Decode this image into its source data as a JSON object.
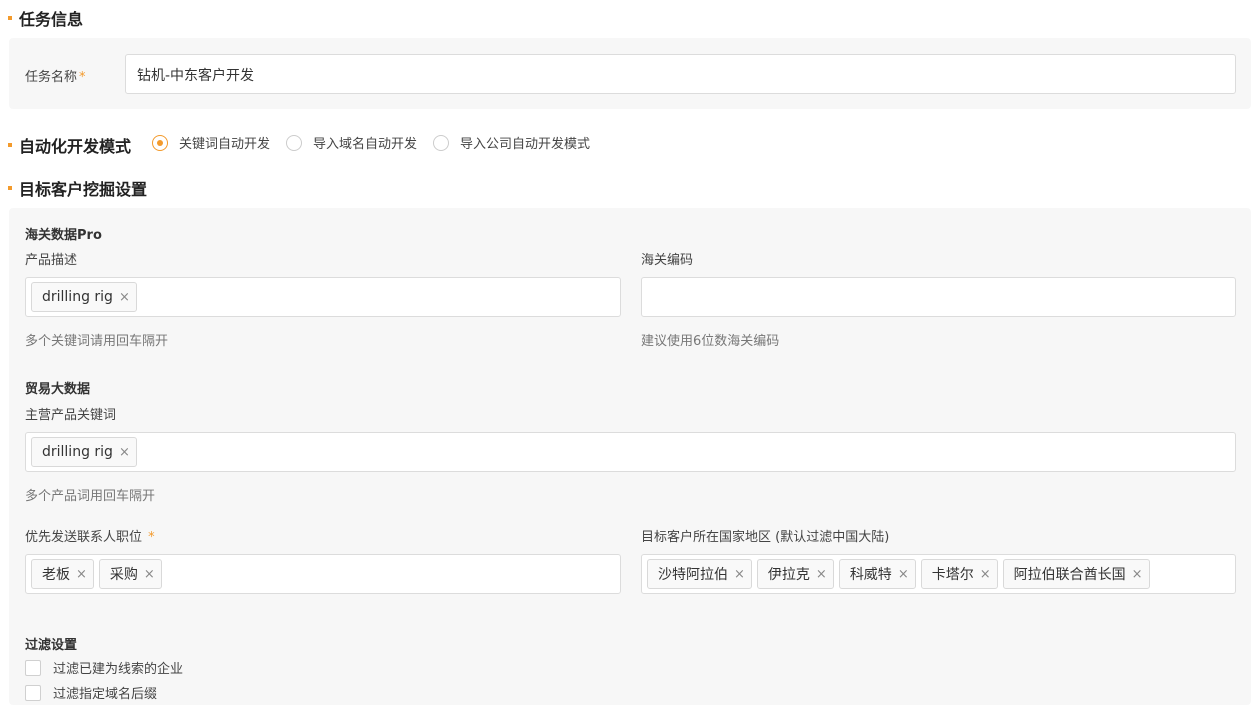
{
  "task_info": {
    "title": "任务信息",
    "name_label": "任务名称",
    "required_mark": "*",
    "name_value": "钻机-中东客户开发"
  },
  "mode": {
    "title": "自动化开发模式",
    "options": [
      {
        "label": "关键词自动开发",
        "selected": true
      },
      {
        "label": "导入域名自动开发",
        "selected": false
      },
      {
        "label": "导入公司自动开发模式",
        "selected": false
      }
    ]
  },
  "target": {
    "title": "目标客户挖掘设置",
    "customs": {
      "title": "海关数据Pro",
      "product_label": "产品描述",
      "product_tags": [
        "drilling rig"
      ],
      "product_hint": "多个关键词请用回车隔开",
      "hs_label": "海关编码",
      "hs_value": "",
      "hs_hint": "建议使用6位数海关编码"
    },
    "trade": {
      "title": "贸易大数据",
      "keywords_label": "主营产品关键词",
      "keywords_tags": [
        "drilling rig"
      ],
      "keywords_hint": "多个产品词用回车隔开"
    },
    "contact": {
      "label": "优先发送联系人职位",
      "required_mark": "*",
      "tags": [
        "老板",
        "采购"
      ]
    },
    "region": {
      "label": "目标客户所在国家地区 (默认过滤中国大陆)",
      "tags": [
        "沙特阿拉伯",
        "伊拉克",
        "科威特",
        "卡塔尔",
        "阿拉伯联合酋长国"
      ]
    },
    "filter": {
      "title": "过滤设置",
      "options": [
        {
          "label": "过滤已建为线索的企业",
          "checked": false
        },
        {
          "label": "过滤指定域名后缀",
          "checked": false
        }
      ]
    }
  },
  "icons": {
    "tag_remove": "×"
  }
}
